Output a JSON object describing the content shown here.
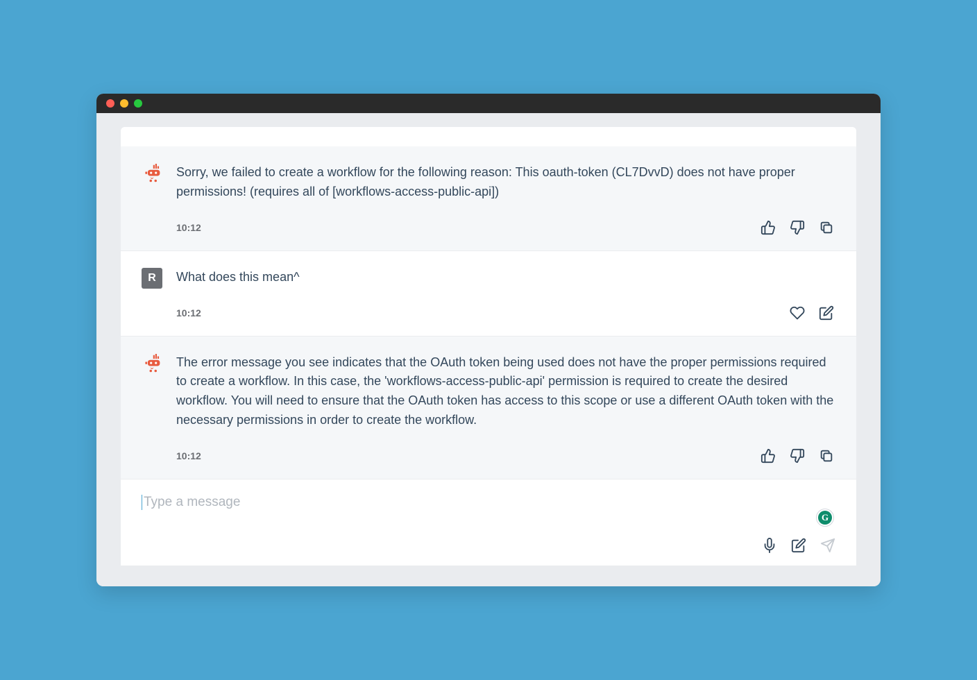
{
  "messages": [
    {
      "role": "bot",
      "text": "Sorry, we failed to create a workflow for the following reason: This oauth-token (CL7DvvD) does not have proper permissions! (requires all of [workflows-access-public-api])",
      "time": "10:12",
      "actions": [
        "thumbs-up",
        "thumbs-down",
        "copy"
      ]
    },
    {
      "role": "user",
      "avatar_letter": "R",
      "text": "What does this mean^",
      "time": "10:12",
      "actions": [
        "heart",
        "edit"
      ]
    },
    {
      "role": "bot",
      "text": "The error message you see indicates that the OAuth token being used does not have the proper permissions required to create a workflow. In this case, the 'workflows-access-public-api' permission is required to create the desired workflow. You will need to ensure that the OAuth token has access to this scope or use a different OAuth token with the necessary permissions in order to create the workflow.",
      "time": "10:12",
      "actions": [
        "thumbs-up",
        "thumbs-down",
        "copy"
      ]
    }
  ],
  "composer": {
    "placeholder": "Type a message",
    "value": ""
  },
  "icons": {
    "thumbs-up": "thumbs-up-icon",
    "thumbs-down": "thumbs-down-icon",
    "copy": "copy-icon",
    "heart": "heart-icon",
    "edit": "edit-icon",
    "mic": "mic-icon",
    "compose": "compose-icon",
    "send": "send-icon"
  },
  "grammarly_letter": "G"
}
